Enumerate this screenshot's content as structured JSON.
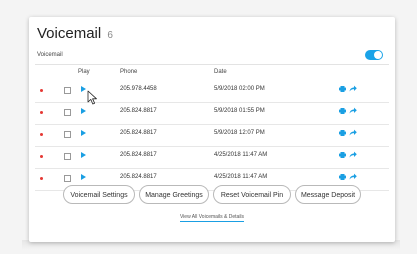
{
  "header": {
    "title": "Voicemail",
    "count": "6",
    "subtitle": "Voicemail",
    "toggle_on": true
  },
  "table": {
    "columns": [
      "Play",
      "Phone",
      "Date"
    ],
    "rows": [
      {
        "phone": "205.978.4458",
        "date": "5/9/2018 02:00 PM"
      },
      {
        "phone": "205.824.8817",
        "date": "5/9/2018 01:55 PM"
      },
      {
        "phone": "205.824.8817",
        "date": "5/9/2018 12:07 PM"
      },
      {
        "phone": "205.824.8817",
        "date": "4/25/2018 11:47 AM"
      },
      {
        "phone": "205.824.8817",
        "date": "4/25/2018 11:47 AM"
      }
    ]
  },
  "buttons": {
    "voicemail_settings": "Voicemail Settings",
    "manage_greetings": "Manage Greetings",
    "reset_pin": "Reset Voicemail Pin",
    "message_deposit": "Message Deposit"
  },
  "links": {
    "view_all": "View All Voicemails & Details"
  },
  "colors": {
    "accent": "#1a9fe3",
    "unread_dot": "#e53935",
    "toggle": "#1aa3e8"
  },
  "icons": [
    "unread-dot-icon",
    "checkbox",
    "play-icon",
    "printer-icon",
    "forward-icon",
    "cursor-icon"
  ]
}
